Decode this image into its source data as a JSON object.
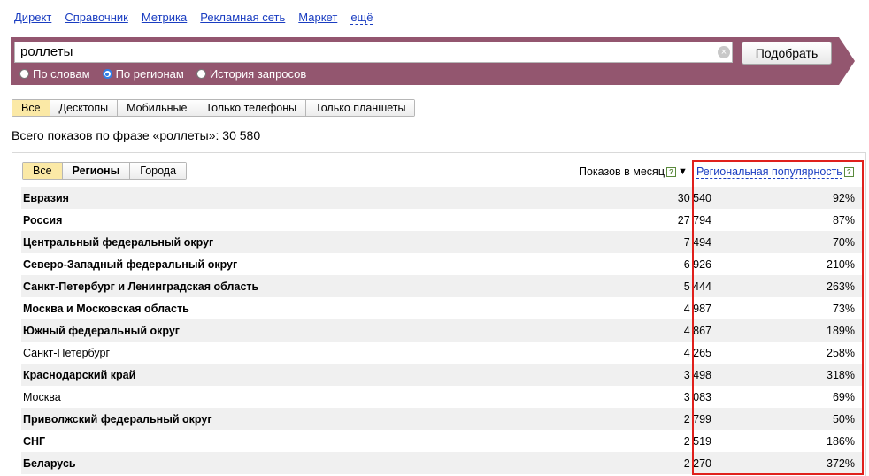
{
  "nav": [
    "Директ",
    "Справочник",
    "Метрика",
    "Рекламная сеть",
    "Маркет",
    "ещё"
  ],
  "search": {
    "value": "роллеты",
    "clear_icon": "×",
    "button": "Подобрать"
  },
  "modes": [
    {
      "label": "По словам",
      "checked": false
    },
    {
      "label": "По регионам",
      "checked": true
    },
    {
      "label": "История запросов",
      "checked": false
    }
  ],
  "device_tabs": [
    "Все",
    "Десктопы",
    "Мобильные",
    "Только телефоны",
    "Только планшеты"
  ],
  "total_text": "Всего показов по фразе «роллеты»: 30 580",
  "region_tabs": [
    "Все",
    "Регионы",
    "Города"
  ],
  "columns": {
    "shows": "Показов в месяц",
    "help": "?",
    "sort": "▼",
    "popularity": "Региональная популярность"
  },
  "rows": [
    {
      "name": "Евразия",
      "shows": "30 540",
      "pop": "92%",
      "bold": true
    },
    {
      "name": "Россия",
      "shows": "27 794",
      "pop": "87%",
      "bold": true
    },
    {
      "name": "Центральный федеральный округ",
      "shows": "7 494",
      "pop": "70%",
      "bold": true
    },
    {
      "name": "Северо-Западный федеральный округ",
      "shows": "6 926",
      "pop": "210%",
      "bold": true
    },
    {
      "name": "Санкт-Петербург и Ленинградская область",
      "shows": "5 444",
      "pop": "263%",
      "bold": true
    },
    {
      "name": "Москва и Московская область",
      "shows": "4 987",
      "pop": "73%",
      "bold": true
    },
    {
      "name": "Южный федеральный округ",
      "shows": "4 867",
      "pop": "189%",
      "bold": true
    },
    {
      "name": "Санкт-Петербург",
      "shows": "4 265",
      "pop": "258%",
      "bold": false
    },
    {
      "name": "Краснодарский край",
      "shows": "3 498",
      "pop": "318%",
      "bold": true
    },
    {
      "name": "Москва",
      "shows": "3 083",
      "pop": "69%",
      "bold": false
    },
    {
      "name": "Приволжский федеральный округ",
      "shows": "2 799",
      "pop": "50%",
      "bold": true
    },
    {
      "name": "СНГ",
      "shows": "2 519",
      "pop": "186%",
      "bold": true
    },
    {
      "name": "Беларусь",
      "shows": "2 270",
      "pop": "372%",
      "bold": true
    }
  ],
  "colors": {
    "band": "#93566f",
    "link": "#1a3dc1",
    "highlight": "#e0201c",
    "active_tab": "#fbe9a6"
  }
}
